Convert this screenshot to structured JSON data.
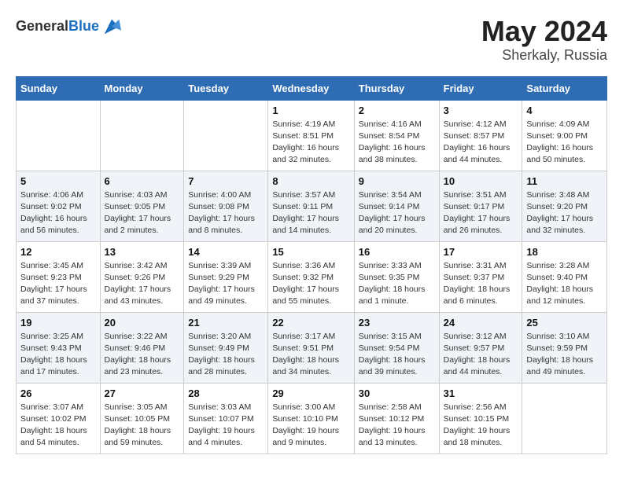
{
  "header": {
    "logo_general": "General",
    "logo_blue": "Blue",
    "month_year": "May 2024",
    "location": "Sherkaly, Russia"
  },
  "weekdays": [
    "Sunday",
    "Monday",
    "Tuesday",
    "Wednesday",
    "Thursday",
    "Friday",
    "Saturday"
  ],
  "weeks": [
    [
      {
        "day": "",
        "info": ""
      },
      {
        "day": "",
        "info": ""
      },
      {
        "day": "",
        "info": ""
      },
      {
        "day": "1",
        "info": "Sunrise: 4:19 AM\nSunset: 8:51 PM\nDaylight: 16 hours\nand 32 minutes."
      },
      {
        "day": "2",
        "info": "Sunrise: 4:16 AM\nSunset: 8:54 PM\nDaylight: 16 hours\nand 38 minutes."
      },
      {
        "day": "3",
        "info": "Sunrise: 4:12 AM\nSunset: 8:57 PM\nDaylight: 16 hours\nand 44 minutes."
      },
      {
        "day": "4",
        "info": "Sunrise: 4:09 AM\nSunset: 9:00 PM\nDaylight: 16 hours\nand 50 minutes."
      }
    ],
    [
      {
        "day": "5",
        "info": "Sunrise: 4:06 AM\nSunset: 9:02 PM\nDaylight: 16 hours\nand 56 minutes."
      },
      {
        "day": "6",
        "info": "Sunrise: 4:03 AM\nSunset: 9:05 PM\nDaylight: 17 hours\nand 2 minutes."
      },
      {
        "day": "7",
        "info": "Sunrise: 4:00 AM\nSunset: 9:08 PM\nDaylight: 17 hours\nand 8 minutes."
      },
      {
        "day": "8",
        "info": "Sunrise: 3:57 AM\nSunset: 9:11 PM\nDaylight: 17 hours\nand 14 minutes."
      },
      {
        "day": "9",
        "info": "Sunrise: 3:54 AM\nSunset: 9:14 PM\nDaylight: 17 hours\nand 20 minutes."
      },
      {
        "day": "10",
        "info": "Sunrise: 3:51 AM\nSunset: 9:17 PM\nDaylight: 17 hours\nand 26 minutes."
      },
      {
        "day": "11",
        "info": "Sunrise: 3:48 AM\nSunset: 9:20 PM\nDaylight: 17 hours\nand 32 minutes."
      }
    ],
    [
      {
        "day": "12",
        "info": "Sunrise: 3:45 AM\nSunset: 9:23 PM\nDaylight: 17 hours\nand 37 minutes."
      },
      {
        "day": "13",
        "info": "Sunrise: 3:42 AM\nSunset: 9:26 PM\nDaylight: 17 hours\nand 43 minutes."
      },
      {
        "day": "14",
        "info": "Sunrise: 3:39 AM\nSunset: 9:29 PM\nDaylight: 17 hours\nand 49 minutes."
      },
      {
        "day": "15",
        "info": "Sunrise: 3:36 AM\nSunset: 9:32 PM\nDaylight: 17 hours\nand 55 minutes."
      },
      {
        "day": "16",
        "info": "Sunrise: 3:33 AM\nSunset: 9:35 PM\nDaylight: 18 hours\nand 1 minute."
      },
      {
        "day": "17",
        "info": "Sunrise: 3:31 AM\nSunset: 9:37 PM\nDaylight: 18 hours\nand 6 minutes."
      },
      {
        "day": "18",
        "info": "Sunrise: 3:28 AM\nSunset: 9:40 PM\nDaylight: 18 hours\nand 12 minutes."
      }
    ],
    [
      {
        "day": "19",
        "info": "Sunrise: 3:25 AM\nSunset: 9:43 PM\nDaylight: 18 hours\nand 17 minutes."
      },
      {
        "day": "20",
        "info": "Sunrise: 3:22 AM\nSunset: 9:46 PM\nDaylight: 18 hours\nand 23 minutes."
      },
      {
        "day": "21",
        "info": "Sunrise: 3:20 AM\nSunset: 9:49 PM\nDaylight: 18 hours\nand 28 minutes."
      },
      {
        "day": "22",
        "info": "Sunrise: 3:17 AM\nSunset: 9:51 PM\nDaylight: 18 hours\nand 34 minutes."
      },
      {
        "day": "23",
        "info": "Sunrise: 3:15 AM\nSunset: 9:54 PM\nDaylight: 18 hours\nand 39 minutes."
      },
      {
        "day": "24",
        "info": "Sunrise: 3:12 AM\nSunset: 9:57 PM\nDaylight: 18 hours\nand 44 minutes."
      },
      {
        "day": "25",
        "info": "Sunrise: 3:10 AM\nSunset: 9:59 PM\nDaylight: 18 hours\nand 49 minutes."
      }
    ],
    [
      {
        "day": "26",
        "info": "Sunrise: 3:07 AM\nSunset: 10:02 PM\nDaylight: 18 hours\nand 54 minutes."
      },
      {
        "day": "27",
        "info": "Sunrise: 3:05 AM\nSunset: 10:05 PM\nDaylight: 18 hours\nand 59 minutes."
      },
      {
        "day": "28",
        "info": "Sunrise: 3:03 AM\nSunset: 10:07 PM\nDaylight: 19 hours\nand 4 minutes."
      },
      {
        "day": "29",
        "info": "Sunrise: 3:00 AM\nSunset: 10:10 PM\nDaylight: 19 hours\nand 9 minutes."
      },
      {
        "day": "30",
        "info": "Sunrise: 2:58 AM\nSunset: 10:12 PM\nDaylight: 19 hours\nand 13 minutes."
      },
      {
        "day": "31",
        "info": "Sunrise: 2:56 AM\nSunset: 10:15 PM\nDaylight: 19 hours\nand 18 minutes."
      },
      {
        "day": "",
        "info": ""
      }
    ]
  ]
}
